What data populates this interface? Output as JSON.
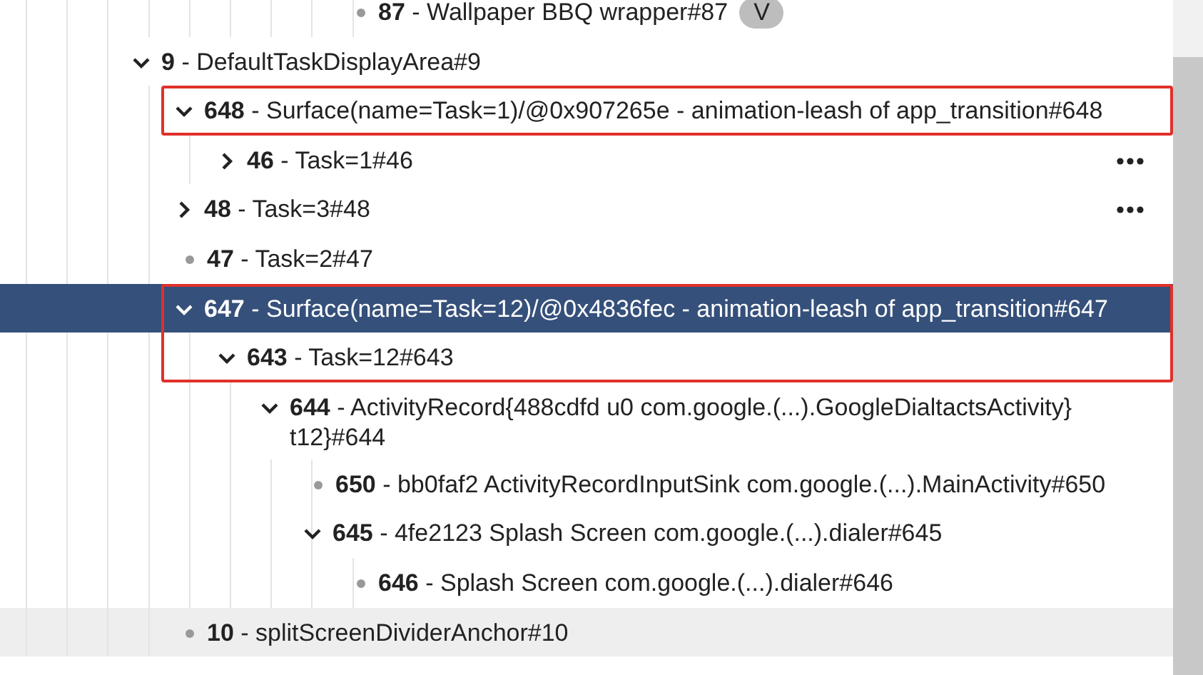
{
  "tree": {
    "top_partial": {
      "label": "**87** - Wallpaper BBQ wrapper#87",
      "kind": "leaf",
      "badge": "V"
    },
    "nodes": [
      {
        "label": "**9** - DefaultTaskDisplayArea#9",
        "kind": "branch",
        "expanded": true,
        "children": [
          {
            "label": "**648** - Surface(name=Task=1)/@0x907265e - animation-leash of app_transition#648",
            "kind": "branch",
            "expanded": true,
            "outlined": true,
            "children": [
              {
                "label": "**46** - Task=1#46",
                "kind": "branch",
                "expanded": false,
                "menu": true
              }
            ]
          },
          {
            "label": "**48** - Task=3#48",
            "kind": "branch",
            "expanded": false,
            "menu": true
          },
          {
            "label": "**47** - Task=2#47",
            "kind": "leaf"
          },
          {
            "label": "**647** - Surface(name=Task=12)/@0x4836fec - animation-leash of app_transition#647",
            "kind": "branch",
            "expanded": true,
            "selected": true,
            "outlined": true,
            "children": [
              {
                "label": "**643** - Task=12#643",
                "kind": "branch",
                "expanded": true,
                "outlined": true,
                "children": [
                  {
                    "label": "**644** - ActivityRecord{488cdfd u0 com.google.(...).GoogleDialtactsActivity} t12}#644",
                    "kind": "branch",
                    "expanded": true,
                    "children": [
                      {
                        "label": "**650** - bb0faf2 ActivityRecordInputSink com.google.(...).MainActivity#650",
                        "kind": "leaf"
                      },
                      {
                        "label": "**645** - 4fe2123 Splash Screen com.google.(...).dialer#645",
                        "kind": "branch",
                        "expanded": true,
                        "children": [
                          {
                            "label": "**646** - Splash Screen com.google.(...).dialer#646",
                            "kind": "leaf"
                          }
                        ]
                      }
                    ]
                  }
                ]
              }
            ]
          },
          {
            "label": "**10** - splitScreenDividerAnchor#10",
            "kind": "leaf",
            "hovered": true
          }
        ]
      }
    ]
  }
}
